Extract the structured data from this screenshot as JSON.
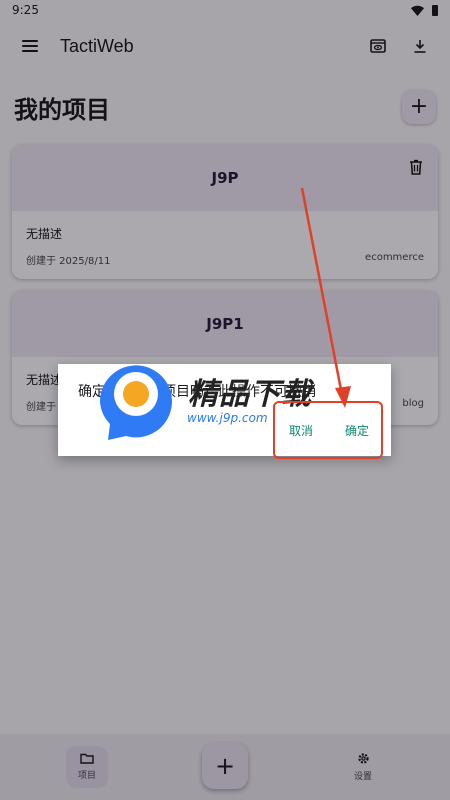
{
  "status_bar": {
    "time": "9:25"
  },
  "app_bar": {
    "title": "TactiWeb"
  },
  "page": {
    "title": "我的项目",
    "add_label": "+"
  },
  "projects": [
    {
      "name": "J9P",
      "description": "无描述",
      "created": "创建于 2025/8/11",
      "tag": "ecommerce"
    },
    {
      "name": "J9P1",
      "description": "无描述",
      "created": "创建于",
      "tag": "blog"
    }
  ],
  "dialog": {
    "message": "确定删除这个项目吗？此操作不可撤销",
    "cancel_label": "取消",
    "confirm_label": "确定"
  },
  "watermark": {
    "title": "精品下载",
    "url": "www.j9p.com"
  },
  "annotation_color": "#e0402a",
  "bottom_nav": {
    "projects_label": "项目",
    "fab_label": "+",
    "settings_label": "设置"
  }
}
